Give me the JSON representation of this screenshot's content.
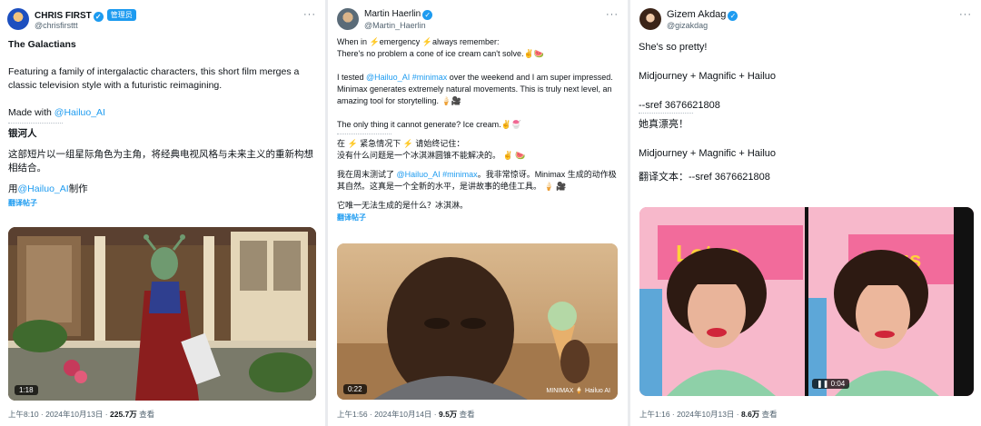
{
  "tweets": [
    {
      "name": "CHRIS FIRST",
      "handle": "@chrisfirsttt",
      "badge": "管理员",
      "title": "The Galactians",
      "body": "Featuring a family of intergalactic characters, this short film merges a classic television style with a futuristic reimagining.",
      "made_with": "Made with ",
      "made_with_link": "@Hailuo_AI",
      "cn_title": "银河人",
      "cn_body": "这部短片以一组星际角色为主角，将经典电视风格与未来主义的重新构想相结合。",
      "cn_made_pre": "用",
      "cn_made_link": "@Hailuo_AI",
      "cn_made_post": "制作",
      "translate_label": "翻译帖子",
      "duration": "1:18",
      "time": "上午8:10 · 2024年10月13日 · ",
      "views": "225.7万",
      "views_label": " 查看"
    },
    {
      "name": "Martin Haerlin",
      "handle": "@Martin_Haerlin",
      "l1": "When in ⚡emergency ⚡always remember:",
      "l2": "There's no problem a cone of ice cream can't solve.✌️🍉",
      "l3_pre": "I tested ",
      "l3_link": "@Hailuo_AI #minimax",
      "l3_post": " over the weekend and I am super impressed. Minimax generates extremely natural movements. This is truly next level, an amazing tool for storytelling. 🍦🎥",
      "l4": "The only thing it cannot generate? Ice cream.✌️🍧",
      "cn1": "在 ⚡ 紧急情况下 ⚡ 请始终记住：",
      "cn2": "没有什么问题是一个冰淇淋圆锥不能解决的。 ✌️ 🍉",
      "cn3_pre": "我在周末测试了 ",
      "cn3_link": "@Hailuo_AI #minimax",
      "cn3_post": "。我非常惊讶。Minimax 生成的动作极其自然。这真是一个全新的水平，是讲故事的绝佳工具。 🍦 🎥",
      "cn4": "它唯一无法生成的是什么？冰淇淋。",
      "translate_label": "翻译帖子",
      "duration": "0:22",
      "watermark": "MINIMAX 🍦 Hailuo AI",
      "time": "上午1:56 · 2024年10月14日 · ",
      "views": "9.5万",
      "views_label": " 查看"
    },
    {
      "name": "Gizem Akdag",
      "handle": "@gizakdag",
      "l1": "She's so pretty!",
      "l2": "Midjourney + Magnific + Hailuo",
      "l3": "--sref 3676621808",
      "cn1": "她真漂亮！",
      "cn2": "Midjourney + Magnific + Hailuo",
      "cn3": "翻译文本：--sref 3676621808",
      "sign_text": "Lotus",
      "duration": "0:04",
      "time": "上午1:16 · 2024年10月13日 · ",
      "views": "8.6万",
      "views_label": " 查看"
    }
  ],
  "colors": {
    "link": "#1d9bf0",
    "verified": "#1d9bf0",
    "muted": "#536471"
  },
  "icons": [
    "verified-badge-icon",
    "more-options-icon",
    "pause-icon"
  ]
}
